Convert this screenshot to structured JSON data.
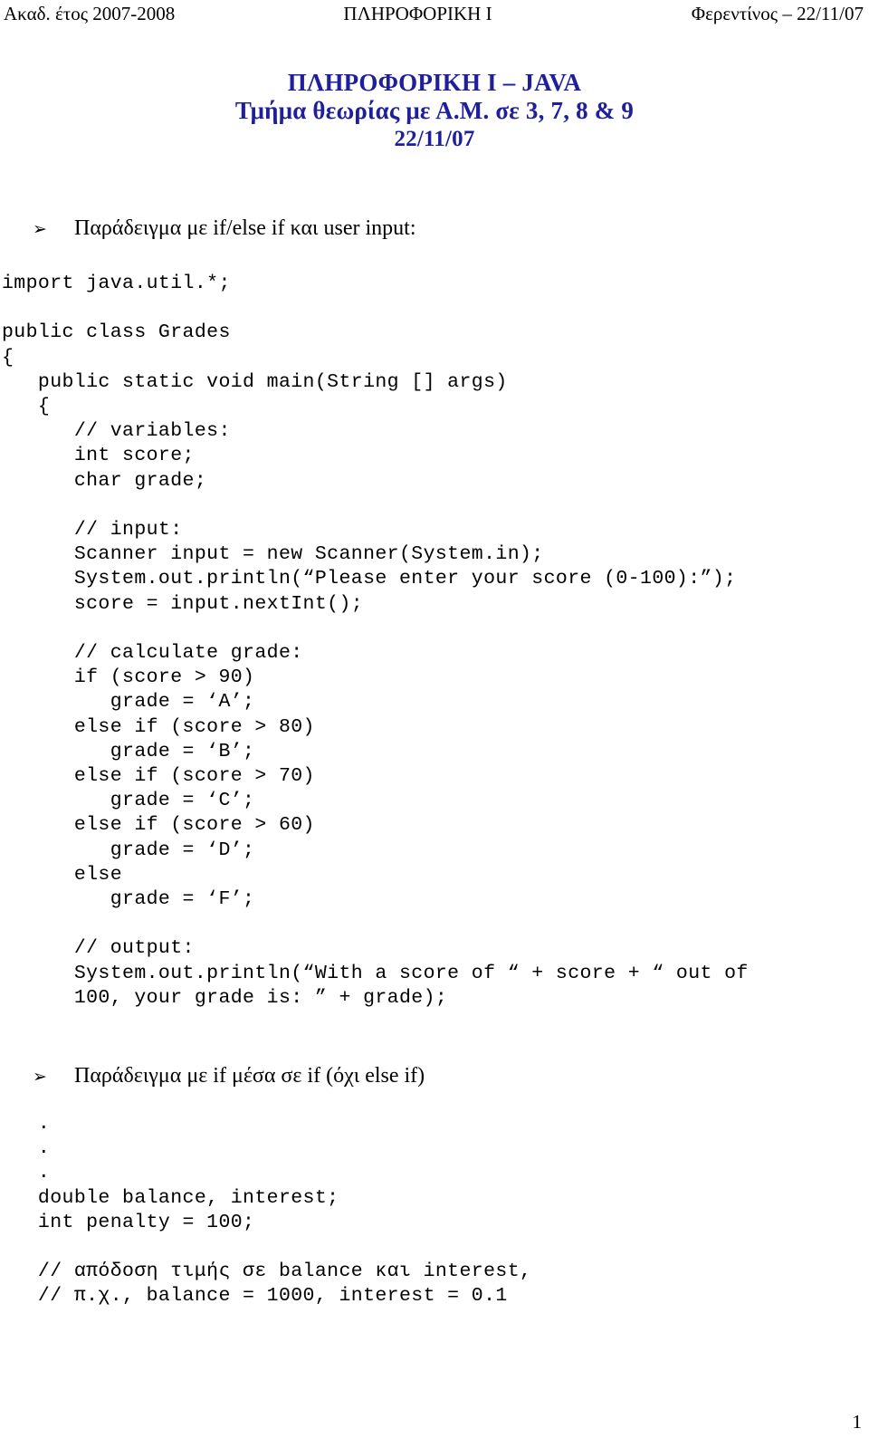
{
  "header": {
    "left": "Ακαδ. έτος 2007-2008",
    "center": "ΠΛΗΡΟΦΟΡΙΚΗ Ι",
    "right": "Φερεντίνος – 22/11/07"
  },
  "title": {
    "line1": "ΠΛΗΡΟΦΟΡΙΚΗ Ι – JAVA",
    "line2": "Τμήμα θεωρίας με Α.Μ. σε 3, 7, 8 & 9",
    "line3": "22/11/07",
    "color": "#1f1f9c"
  },
  "bullets": {
    "glyph": "➢",
    "first": "Παράδειγμα με if/else if και user input:",
    "second": "Παράδειγμα με if μέσα σε if (όχι else if)"
  },
  "code_block_1": [
    "import java.util.*;",
    "",
    "public class Grades",
    "{",
    "   public static void main(String [] args)",
    "   {",
    "      // variables:",
    "      int score;",
    "      char grade;",
    "",
    "      // input:",
    "      Scanner input = new Scanner(System.in);",
    "      System.out.println(“Please enter your score (0-100):”);",
    "      score = input.nextInt();",
    "",
    "      // calculate grade:",
    "      if (score > 90)",
    "         grade = ‘A’;",
    "      else if (score > 80)",
    "         grade = ‘B’;",
    "      else if (score > 70)",
    "         grade = ‘C’;",
    "      else if (score > 60)",
    "         grade = ‘D’;",
    "      else",
    "         grade = ‘F’;",
    "",
    "      // output:",
    "      System.out.println(“With a score of “ + score + “ out of",
    "      100, your grade is: ” + grade);"
  ],
  "code_block_2": [
    "   .",
    "   .",
    "   .",
    "   double balance, interest;",
    "   int penalty = 100;",
    "",
    "   // απόδοση τιμής σε balance και interest,",
    "   // π.χ., balance = 1000, interest = 0.1"
  ],
  "footer": {
    "page_number": "1"
  }
}
